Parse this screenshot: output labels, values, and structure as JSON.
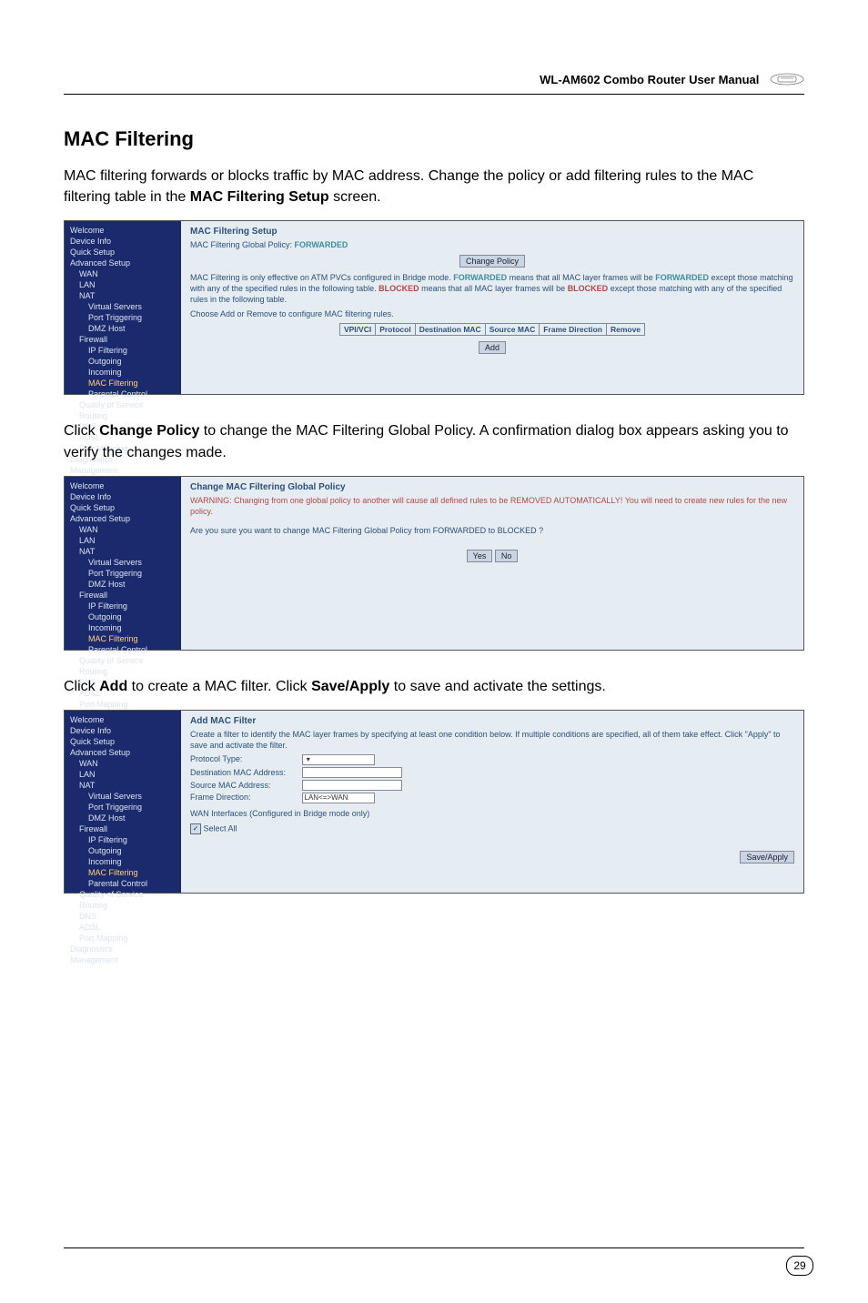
{
  "header": {
    "manual_title": "WL-AM602 Combo Router User Manual"
  },
  "section": {
    "title": "MAC Filtering",
    "intro_a": "MAC filtering forwards or blocks traffic by MAC address. Change the policy or add filtering rules to the MAC filtering table in the ",
    "intro_bold": "MAC Filtering Setup",
    "intro_b": " screen.",
    "para2_a": "Click ",
    "para2_bold": "Change Policy",
    "para2_b": " to change the MAC Filtering Global Policy. A confirmation dialog box appears asking you to verify the changes made.",
    "para3_a": "Click ",
    "para3_bold1": "Add",
    "para3_mid": " to create a MAC filter. Click ",
    "para3_bold2": "Save/Apply",
    "para3_b": " to save and activate the settings."
  },
  "sidebar": {
    "items": [
      {
        "label": "Welcome",
        "lvl": "lvl1"
      },
      {
        "label": "Device Info",
        "lvl": "lvl1"
      },
      {
        "label": "Quick Setup",
        "lvl": "lvl1"
      },
      {
        "label": "Advanced Setup",
        "lvl": "lvl1"
      },
      {
        "label": "WAN",
        "lvl": "lvl2"
      },
      {
        "label": "LAN",
        "lvl": "lvl2"
      },
      {
        "label": "NAT",
        "lvl": "lvl2"
      },
      {
        "label": "Virtual Servers",
        "lvl": "lvl3"
      },
      {
        "label": "Port Triggering",
        "lvl": "lvl3"
      },
      {
        "label": "DMZ Host",
        "lvl": "lvl3"
      },
      {
        "label": "Firewall",
        "lvl": "lvl2"
      },
      {
        "label": "IP Filtering",
        "lvl": "lvl3"
      },
      {
        "label": "Outgoing",
        "lvl": "lvl3"
      },
      {
        "label": "Incoming",
        "lvl": "lvl3"
      },
      {
        "label": "MAC Filtering",
        "lvl": "lvl3",
        "active": true
      },
      {
        "label": "Parental Control",
        "lvl": "lvl3"
      },
      {
        "label": "Quality of Service",
        "lvl": "lvl2"
      },
      {
        "label": "Routing",
        "lvl": "lvl2"
      },
      {
        "label": "DNS",
        "lvl": "lvl2"
      },
      {
        "label": "ADSL",
        "lvl": "lvl2"
      },
      {
        "label": "Port Mapping",
        "lvl": "lvl2"
      },
      {
        "label": "Diagnostics",
        "lvl": "lvl1"
      },
      {
        "label": "Management",
        "lvl": "lvl1"
      }
    ]
  },
  "shot1": {
    "title": "MAC Filtering Setup",
    "policy_prefix": "MAC Filtering Global Policy: ",
    "policy_value": "FORWARDED",
    "btn_change": "Change Policy",
    "desc": "MAC Filtering is only effective on ATM PVCs configured in Bridge mode. FORWARDED means that all MAC layer frames will be FORWARDED except those matching with any of the specified rules in the following table. BLOCKED means that all MAC layer frames will be BLOCKED except those matching with any of the specified rules in the following table.",
    "desc2": "Choose Add or Remove to configure MAC filtering rules.",
    "table_headers": [
      "VPI/VCI",
      "Protocol",
      "Destination MAC",
      "Source MAC",
      "Frame Direction",
      "Remove"
    ],
    "btn_add": "Add"
  },
  "shot2": {
    "title": "Change MAC Filtering Global Policy",
    "warn": "WARNING: Changing from one global policy to another will cause all defined rules to be REMOVED AUTOMATICALLY! You will need to create new rules for the new policy.",
    "confirm": "Are you sure you want to change MAC Filtering Global Policy from FORWARDED to BLOCKED ?",
    "btn_yes": "Yes",
    "btn_no": "No"
  },
  "shot3": {
    "title": "Add MAC Filter",
    "desc": "Create a filter to identify the MAC layer frames by specifying at least one condition below. If multiple conditions are specified, all of them take effect. Click \"Apply\" to save and activate the filter.",
    "fields": {
      "protocol_label": "Protocol Type:",
      "dest_label": "Destination MAC Address:",
      "src_label": "Source MAC Address:",
      "dir_label": "Frame Direction:",
      "dir_value": "LAN<=>WAN",
      "wan_label": "WAN Interfaces (Configured in Bridge mode only)",
      "select_all": "Select All"
    },
    "btn_save": "Save/Apply"
  },
  "page_number": "29"
}
